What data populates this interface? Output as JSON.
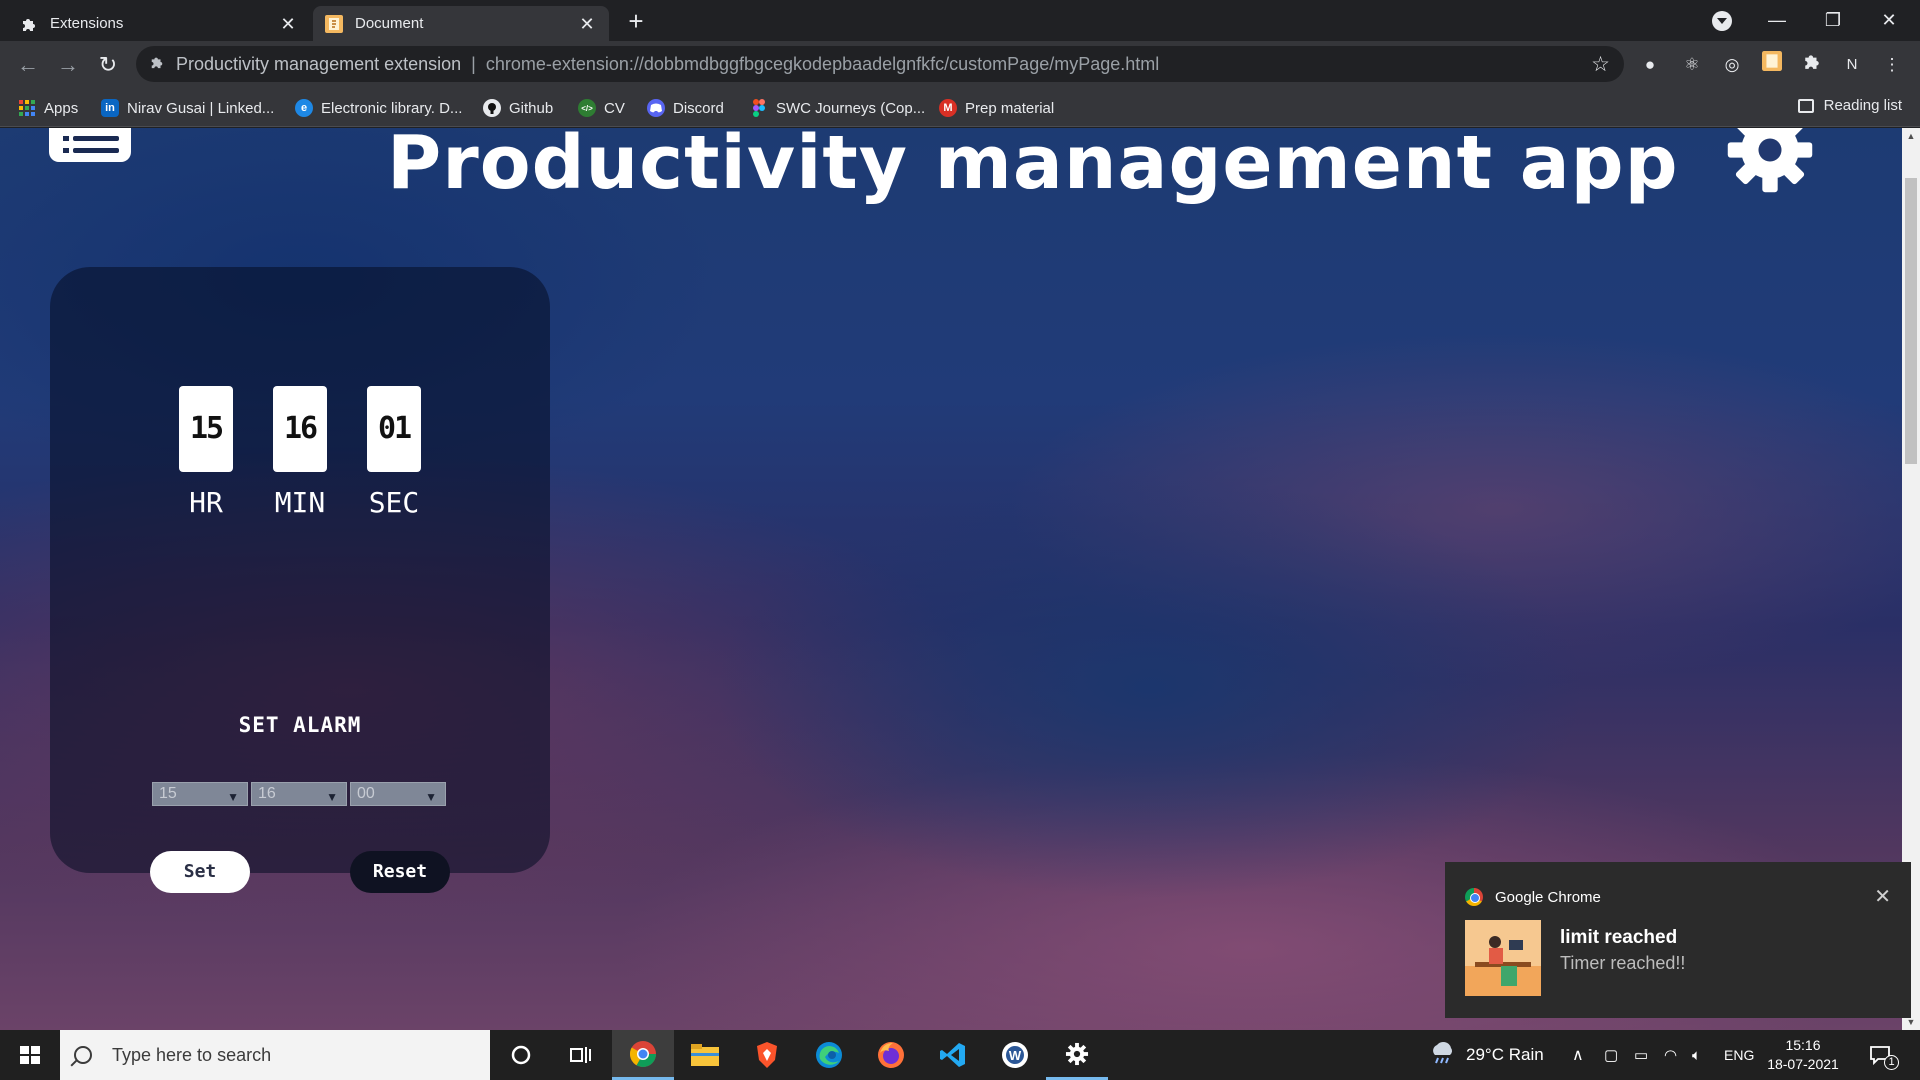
{
  "browser": {
    "tabs": [
      {
        "title": "Extensions",
        "favicon": "puzzle-icon"
      },
      {
        "title": "Document",
        "favicon": "extension-logo-icon"
      }
    ],
    "new_tab_label": "+",
    "omnibox": {
      "site_label": "Productivity management extension",
      "separator": "|",
      "url": "chrome-extension://dobbmdbggfbgcegkodepbaadelgnfkfc/customPage/myPage.html"
    },
    "profile_initial": "N",
    "bookmarks": [
      {
        "label": "Apps",
        "color": "#ea4335"
      },
      {
        "label": "Nirav Gusai | Linked...",
        "color": "#0a66c2",
        "glyph": "in"
      },
      {
        "label": "Electronic library. D...",
        "color": "#1e88e5",
        "glyph": "e"
      },
      {
        "label": "Github",
        "color": "#111111"
      },
      {
        "label": "CV",
        "color": "#2e7d32"
      },
      {
        "label": "Discord",
        "color": "#5865f2"
      },
      {
        "label": "SWC Journeys (Cop...",
        "color": "#f24e1e"
      },
      {
        "label": "Prep material",
        "color": "#d93025",
        "glyph": "M"
      }
    ],
    "reading_list": "Reading list"
  },
  "app": {
    "title": "Productivity management app",
    "timer": {
      "hours": "15",
      "minutes": "16",
      "seconds": "01",
      "hours_label": "HR",
      "minutes_label": "MIN",
      "seconds_label": "SEC"
    },
    "alarm": {
      "heading": "SET ALARM",
      "hour_select": "15",
      "minute_select": "16",
      "second_select": "00",
      "set_label": "Set",
      "reset_label": "Reset"
    }
  },
  "notification": {
    "app_name": "Google Chrome",
    "title": "limit reached",
    "body": "Timer reached!!"
  },
  "taskbar": {
    "search_placeholder": "Type here to search",
    "weather": "29°C  Rain",
    "language": "ENG",
    "time": "15:16",
    "date": "18-07-2021",
    "notification_count": "1"
  }
}
